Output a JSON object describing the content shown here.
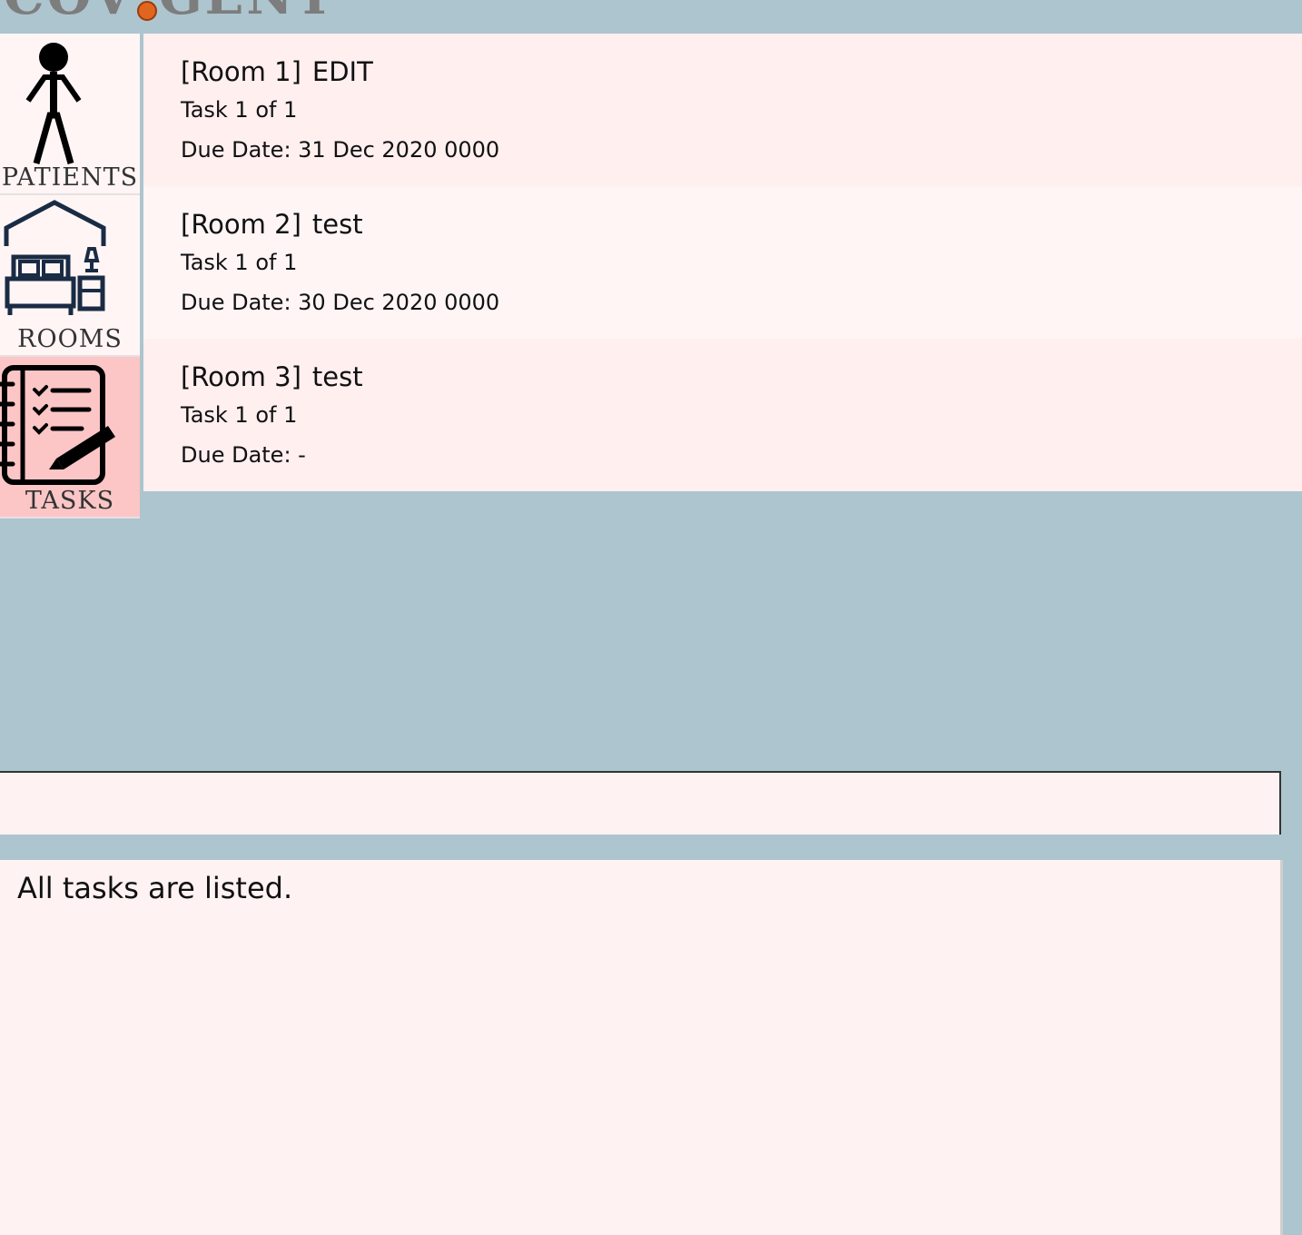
{
  "app": {
    "logo_text": "COVIGENT"
  },
  "sidebar": {
    "tabs": [
      {
        "label": "PATIENTS",
        "icon": "stick-figure-icon",
        "active": false
      },
      {
        "label": "ROOMS",
        "icon": "bedroom-icon",
        "active": false
      },
      {
        "label": "TASKS",
        "icon": "task-notebook-icon",
        "active": true
      }
    ]
  },
  "tasks": [
    {
      "room": "[Room 1]",
      "description": "EDIT",
      "task_index": "Task 1 of 1",
      "due_date": "Due Date: 31 Dec 2020 0000"
    },
    {
      "room": "[Room 2]",
      "description": "test",
      "task_index": "Task 1 of 1",
      "due_date": "Due Date: 30 Dec 2020 0000"
    },
    {
      "room": "[Room 3]",
      "description": "test",
      "task_index": "Task 1 of 1",
      "due_date": "Due Date: -"
    }
  ],
  "command": {
    "value": "",
    "placeholder": ""
  },
  "result": {
    "message": "All tasks are listed."
  },
  "colors": {
    "background": "#adc5cf",
    "card_a": "#ffefef",
    "card_b": "#fff5f5",
    "active_tab": "#fcc6c6",
    "logo_dot": "#e0661f"
  }
}
